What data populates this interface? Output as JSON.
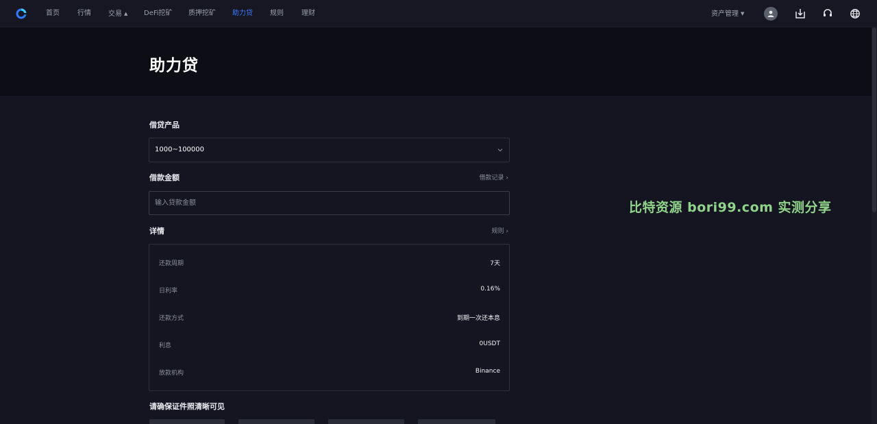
{
  "nav": {
    "logo_icon": "circle-logo-icon",
    "items": [
      {
        "label": "首页"
      },
      {
        "label": "行情"
      },
      {
        "label": "交易",
        "has_caret": true
      },
      {
        "label": "DeFi挖矿"
      },
      {
        "label": "质押挖矿"
      },
      {
        "label": "助力贷",
        "active": true
      },
      {
        "label": "规则"
      },
      {
        "label": "理财"
      }
    ],
    "asset_management": "资产管理",
    "right_icons": [
      "user-avatar-icon",
      "download-icon",
      "headset-icon",
      "globe-icon"
    ]
  },
  "page": {
    "title": "助力贷"
  },
  "form": {
    "product_label": "借贷产品",
    "product_value": "1000~100000",
    "amount_label": "借款金额",
    "loan_records_link": "借款记录",
    "amount_placeholder": "输入贷款金额",
    "details_label": "详情",
    "rules_link": "规则",
    "details": [
      {
        "key": "还款周期",
        "value": "7天"
      },
      {
        "key": "日利率",
        "value": "0.16%"
      },
      {
        "key": "还款方式",
        "value": "到期一次还本息"
      },
      {
        "key": "利息",
        "value": "0USDT"
      },
      {
        "key": "放款机构",
        "value": "Binance"
      }
    ],
    "id_notice": "请确保证件照清晰可见"
  },
  "watermark": "比特资源 bori99.com 实测分享",
  "colors": {
    "accent": "#3d7bff",
    "background": "#141521",
    "hero": "#0d0e15",
    "watermark": "#8fd48a"
  }
}
